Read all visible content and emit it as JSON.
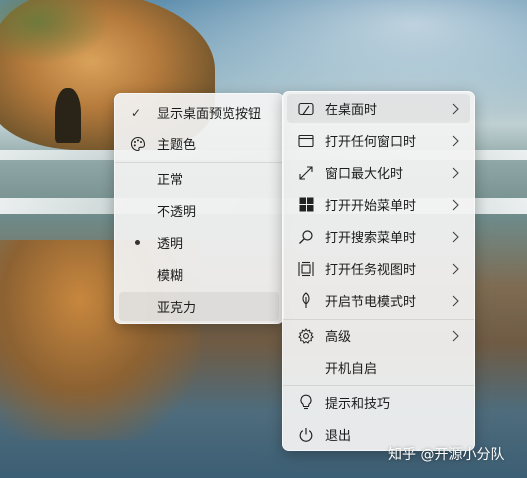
{
  "submenu": {
    "items": [
      {
        "label": "显示桌面预览按钮",
        "checked": true
      },
      {
        "label": "主题色",
        "icon": "palette-icon"
      },
      {
        "label": "正常"
      },
      {
        "label": "不透明"
      },
      {
        "label": "透明",
        "selected": true
      },
      {
        "label": "模糊"
      },
      {
        "label": "亚克力",
        "highlighted": true
      }
    ]
  },
  "mainmenu": {
    "items": [
      {
        "label": "在桌面时",
        "icon": "desktop-icon",
        "has_submenu": true,
        "highlighted": true
      },
      {
        "label": "打开任何窗口时",
        "icon": "window-icon",
        "has_submenu": true
      },
      {
        "label": "窗口最大化时",
        "icon": "maximize-arrow-icon",
        "has_submenu": true
      },
      {
        "label": "打开开始菜单时",
        "icon": "windows-logo-icon",
        "has_submenu": true
      },
      {
        "label": "打开搜索菜单时",
        "icon": "search-icon",
        "has_submenu": true
      },
      {
        "label": "打开任务视图时",
        "icon": "task-view-icon",
        "has_submenu": true
      },
      {
        "label": "开启节电模式时",
        "icon": "leaf-icon",
        "has_submenu": true
      },
      {
        "label": "高级",
        "icon": "gear-icon",
        "has_submenu": true
      },
      {
        "label": "开机自启"
      },
      {
        "label": "提示和技巧",
        "icon": "lightbulb-icon"
      },
      {
        "label": "退出",
        "icon": "power-icon"
      }
    ]
  },
  "watermark": "知乎 @开源小分队"
}
